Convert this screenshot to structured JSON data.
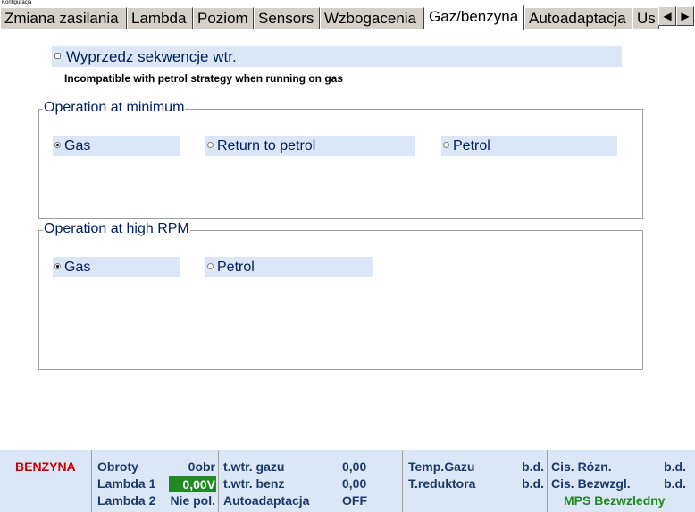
{
  "window": {
    "title": "Konfiguracja"
  },
  "tabs": [
    {
      "label": "Zmiana zasilania",
      "active": false
    },
    {
      "label": "Lambda",
      "active": false
    },
    {
      "label": "Poziom",
      "active": false
    },
    {
      "label": "Sensors",
      "active": false
    },
    {
      "label": "Wzbogacenia",
      "active": false
    },
    {
      "label": "Gaz/benzyna",
      "active": true
    },
    {
      "label": "Autoadaptacja",
      "active": false
    },
    {
      "label": "Us",
      "active": false
    }
  ],
  "tab_nav": {
    "left": "◀",
    "right": "▶"
  },
  "sequence_option": {
    "label": "Wyprzedz sekwencje wtr.",
    "checked": false,
    "note": "Incompatible with petrol strategy when running on gas"
  },
  "operation_minimum": {
    "title": "Operation at minimum",
    "options": [
      {
        "label": "Gas",
        "selected": true
      },
      {
        "label": "Return to petrol",
        "selected": false
      },
      {
        "label": "Petrol",
        "selected": false
      }
    ]
  },
  "operation_high_rpm": {
    "title": "Operation at high RPM",
    "options": [
      {
        "label": "Gas",
        "selected": true
      },
      {
        "label": "Petrol",
        "selected": false
      }
    ]
  },
  "status": {
    "fuel": "BENZYNA",
    "obroty_label": "Obroty",
    "obroty_value": "0obr",
    "lambda1_label": "Lambda 1",
    "lambda1_value": "0,00V",
    "lambda2_label": "Lambda 2",
    "lambda2_value": "Nie pol.",
    "twtr_gazu_label": "t.wtr. gazu",
    "twtr_gazu_value": "0,00",
    "twtr_benz_label": "t.wtr. benz",
    "twtr_benz_value": "0,00",
    "autoadapt_label": "Autoadaptacja",
    "autoadapt_value": "OFF",
    "temp_gazu_label": "Temp.Gazu",
    "temp_gazu_value": "b.d.",
    "t_reduktora_label": "T.reduktora",
    "t_reduktora_value": "b.d.",
    "cis_rozn_label": "Cis. Rózn.",
    "cis_rozn_value": "b.d.",
    "cis_bezwzgl_label": "Cis. Bezwzgl.",
    "cis_bezwzgl_value": "b.d.",
    "mps": "MPS Bezwzledny"
  },
  "colors": {
    "highlight": "#dbe6f7",
    "label_text": "#002060",
    "fuel_red": "#cc0000",
    "ok_green": "#1f8a1f"
  }
}
